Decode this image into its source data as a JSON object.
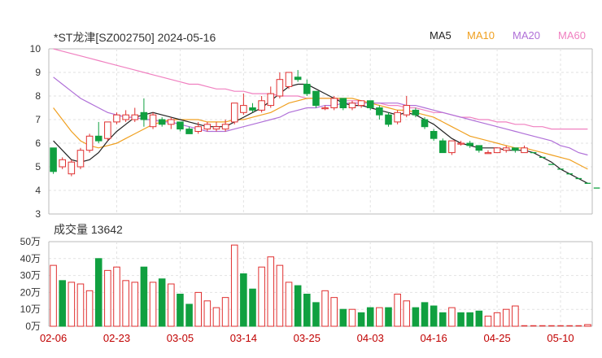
{
  "header": {
    "title": "*ST龙津[SZ002750] 2024-05-16",
    "volume_title": "成交量 13642"
  },
  "legend": [
    {
      "label": "MA5",
      "color": "#222222"
    },
    {
      "label": "MA10",
      "color": "#f0a020"
    },
    {
      "label": "MA20",
      "color": "#b070d8"
    },
    {
      "label": "MA60",
      "color": "#f080c0"
    }
  ],
  "colors": {
    "up": "#e03030",
    "down": "#10a040",
    "forecast": "#10a040"
  },
  "chart_data": [
    {
      "type": "candlestick",
      "title": "*ST龙津[SZ002750] 2024-05-16",
      "ylim": [
        3,
        10
      ],
      "yticks": [
        "10",
        "9",
        "8",
        "7",
        "6",
        "5",
        "4",
        "3"
      ],
      "xlabels": [
        "02-06",
        "02-23",
        "03-05",
        "03-14",
        "03-25",
        "04-03",
        "04-16",
        "04-25",
        "05-10"
      ],
      "xlabel_index": [
        0,
        7,
        14,
        21,
        28,
        35,
        42,
        49,
        56
      ],
      "candles": [
        [
          5.8,
          4.8,
          5.8,
          4.7
        ],
        [
          5.0,
          5.3,
          5.4,
          4.9
        ],
        [
          4.7,
          5.2,
          5.3,
          4.6
        ],
        [
          5.0,
          5.7,
          5.8,
          4.9
        ],
        [
          5.7,
          6.3,
          6.4,
          5.6
        ],
        [
          6.3,
          6.1,
          6.9,
          6.0
        ],
        [
          6.2,
          6.9,
          6.9,
          6.1
        ],
        [
          6.9,
          7.2,
          7.3,
          6.8
        ],
        [
          7.0,
          7.2,
          7.4,
          6.9
        ],
        [
          7.0,
          7.2,
          7.5,
          6.9
        ],
        [
          7.3,
          7.0,
          7.9,
          6.7
        ],
        [
          6.7,
          7.2,
          7.3,
          6.6
        ],
        [
          7.0,
          6.8,
          7.1,
          6.7
        ],
        [
          6.8,
          7.0,
          7.1,
          6.6
        ],
        [
          6.9,
          6.6,
          6.9,
          6.5
        ],
        [
          6.6,
          6.4,
          6.7,
          6.4
        ],
        [
          6.5,
          6.7,
          6.9,
          6.4
        ],
        [
          6.6,
          6.8,
          6.9,
          6.5
        ],
        [
          6.6,
          6.7,
          6.9,
          6.5
        ],
        [
          6.6,
          6.8,
          7.0,
          6.5
        ],
        [
          6.9,
          7.7,
          7.7,
          6.8
        ],
        [
          7.3,
          7.6,
          8.1,
          7.2
        ],
        [
          7.5,
          7.4,
          7.7,
          7.3
        ],
        [
          7.4,
          7.8,
          8.0,
          7.3
        ],
        [
          7.6,
          8.1,
          8.4,
          7.5
        ],
        [
          8.0,
          8.7,
          9.0,
          7.9
        ],
        [
          8.4,
          9.0,
          9.0,
          8.3
        ],
        [
          8.8,
          8.7,
          9.1,
          8.6
        ],
        [
          8.5,
          8.1,
          8.7,
          8.0
        ],
        [
          8.2,
          7.6,
          8.2,
          7.5
        ],
        [
          7.5,
          7.5,
          7.6,
          7.4
        ],
        [
          7.5,
          7.9,
          8.0,
          7.4
        ],
        [
          7.9,
          7.5,
          7.9,
          7.4
        ],
        [
          7.5,
          7.7,
          7.8,
          7.4
        ],
        [
          7.6,
          7.8,
          7.8,
          7.5
        ],
        [
          7.8,
          7.5,
          7.8,
          7.4
        ],
        [
          7.5,
          7.2,
          7.6,
          7.0
        ],
        [
          7.2,
          6.8,
          7.3,
          6.7
        ],
        [
          6.9,
          7.3,
          7.4,
          6.8
        ],
        [
          7.2,
          7.6,
          8.0,
          7.1
        ],
        [
          7.4,
          7.2,
          7.5,
          7.1
        ],
        [
          7.0,
          6.7,
          7.1,
          6.6
        ],
        [
          6.5,
          6.2,
          6.6,
          6.1
        ],
        [
          6.1,
          5.6,
          6.2,
          5.6
        ],
        [
          5.6,
          6.1,
          6.1,
          5.5
        ],
        [
          6.0,
          6.0,
          6.1,
          5.9
        ],
        [
          6.0,
          5.9,
          6.1,
          5.8
        ],
        [
          5.9,
          5.7,
          5.9,
          5.6
        ],
        [
          5.6,
          5.6,
          5.7,
          5.6
        ],
        [
          5.6,
          5.8,
          5.8,
          5.6
        ],
        [
          5.7,
          5.8,
          5.9,
          5.6
        ],
        [
          5.8,
          5.7,
          5.8,
          5.6
        ],
        [
          5.6,
          5.8,
          5.9,
          5.6
        ]
      ],
      "ma": {
        "MA5": [
          6.1,
          5.7,
          5.3,
          5.2,
          5.3,
          5.6,
          6.1,
          6.5,
          6.8,
          7.1,
          7.2,
          7.3,
          7.2,
          7.1,
          7.0,
          6.9,
          6.8,
          6.7,
          6.7,
          6.7,
          6.9,
          7.1,
          7.3,
          7.5,
          7.8,
          8.1,
          8.4,
          8.5,
          8.5,
          8.3,
          8.1,
          7.9,
          7.7,
          7.6,
          7.6,
          7.5,
          7.4,
          7.3,
          7.2,
          7.3,
          7.2,
          7.0,
          6.8,
          6.5,
          6.2,
          6.0,
          5.9,
          5.8,
          5.8,
          5.8,
          5.7,
          5.7,
          5.7,
          5.6,
          5.4,
          5.2,
          4.9,
          4.7,
          4.5,
          4.3
        ],
        "MA10": [
          7.5,
          7.0,
          6.5,
          6.1,
          5.9,
          5.8,
          5.9,
          6.0,
          6.2,
          6.4,
          6.6,
          6.8,
          6.9,
          7.0,
          7.0,
          7.0,
          7.0,
          6.9,
          6.9,
          6.9,
          7.0,
          7.0,
          7.1,
          7.2,
          7.3,
          7.5,
          7.7,
          7.8,
          7.9,
          7.9,
          7.9,
          7.9,
          7.9,
          7.9,
          7.8,
          7.7,
          7.6,
          7.5,
          7.4,
          7.4,
          7.3,
          7.2,
          7.1,
          6.9,
          6.7,
          6.5,
          6.3,
          6.2,
          6.1,
          6.0,
          5.9,
          5.8,
          5.8,
          5.7,
          5.6,
          5.5,
          5.4,
          5.3,
          5.1,
          4.9
        ],
        "MA20": [
          8.8,
          8.5,
          8.2,
          7.9,
          7.7,
          7.5,
          7.3,
          7.2,
          7.1,
          7.1,
          7.0,
          7.0,
          6.9,
          6.9,
          6.8,
          6.7,
          6.6,
          6.5,
          6.5,
          6.5,
          6.6,
          6.7,
          6.8,
          6.9,
          7.0,
          7.1,
          7.3,
          7.4,
          7.5,
          7.5,
          7.6,
          7.6,
          7.7,
          7.7,
          7.7,
          7.7,
          7.7,
          7.7,
          7.7,
          7.6,
          7.6,
          7.5,
          7.4,
          7.3,
          7.2,
          7.1,
          7.0,
          6.9,
          6.8,
          6.7,
          6.6,
          6.5,
          6.4,
          6.3,
          6.2,
          6.1,
          5.9,
          5.8,
          5.6,
          5.5
        ],
        "MA60": [
          10.0,
          9.9,
          9.8,
          9.7,
          9.6,
          9.5,
          9.4,
          9.3,
          9.2,
          9.1,
          9.0,
          8.9,
          8.8,
          8.7,
          8.6,
          8.5,
          8.5,
          8.4,
          8.3,
          8.3,
          8.2,
          8.2,
          8.1,
          8.1,
          8.1,
          8.0,
          8.0,
          8.0,
          7.9,
          7.9,
          7.9,
          7.9,
          7.8,
          7.8,
          7.8,
          7.7,
          7.7,
          7.6,
          7.6,
          7.5,
          7.5,
          7.4,
          7.3,
          7.3,
          7.2,
          7.1,
          7.1,
          7.0,
          7.0,
          6.9,
          6.9,
          6.8,
          6.8,
          6.7,
          6.7,
          6.6,
          6.6,
          6.6,
          6.6,
          6.6
        ]
      },
      "forecast": [
        5.6,
        5.4,
        5.1,
        4.9,
        4.7,
        4.5,
        4.3,
        4.1,
        4.0,
        3.9
      ]
    },
    {
      "type": "bar",
      "title": "成交量 13642",
      "ylim": [
        0,
        50
      ],
      "yticks": [
        "50万",
        "40万",
        "30万",
        "20万",
        "10万",
        "0万"
      ],
      "volumes": [
        36,
        27,
        26,
        25,
        21,
        40,
        33,
        35,
        27,
        26,
        35,
        26,
        28,
        25,
        19,
        13,
        20,
        15,
        11,
        17,
        48,
        31,
        22,
        35,
        41,
        36,
        26,
        24,
        19,
        14,
        21,
        17,
        10,
        10,
        8,
        11,
        11,
        11,
        19,
        15,
        11,
        14,
        12,
        8,
        11,
        8,
        8,
        9,
        6,
        8,
        10,
        12,
        0,
        0,
        0,
        0,
        0,
        0,
        0,
        1
      ],
      "up_down": [
        1,
        0,
        1,
        1,
        1,
        0,
        1,
        1,
        1,
        1,
        0,
        1,
        0,
        1,
        0,
        0,
        1,
        1,
        1,
        1,
        1,
        0,
        0,
        1,
        1,
        1,
        1,
        0,
        0,
        0,
        1,
        1,
        0,
        1,
        0,
        0,
        1,
        0,
        1,
        1,
        0,
        0,
        0,
        0,
        1,
        0,
        0,
        0,
        1,
        1,
        1,
        1,
        1,
        1,
        1,
        1,
        1,
        1,
        1,
        1
      ]
    }
  ]
}
